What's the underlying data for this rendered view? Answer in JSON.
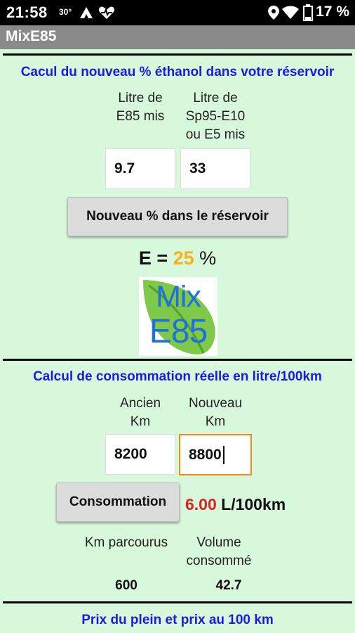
{
  "status_bar": {
    "time": "21:58",
    "temperature": "30°",
    "battery": "17 %"
  },
  "app": {
    "title": "MixE85"
  },
  "ethanol_section": {
    "title": "Cacul du nouveau % éthanol dans votre réservoir",
    "e85_label_line1": "Litre de",
    "e85_label_line2": "E85 mis",
    "sp95_label_line1": "Litre de",
    "sp95_label_line2": "Sp95-E10",
    "sp95_label_line3": "ou E5 mis",
    "e85_value": "9.7",
    "sp95_value": "33",
    "button_label": "Nouveau %  dans le réservoir",
    "result_prefix": "E = ",
    "result_value": "25",
    "result_unit": " %",
    "logo_line1": "Mix",
    "logo_line2": "E85"
  },
  "consumption_section": {
    "title": "Calcul de consommation réelle en litre/100km",
    "old_km_label_line1": "Ancien",
    "old_km_label_line2": "Km",
    "new_km_label_line1": "Nouveau",
    "new_km_label_line2": "Km",
    "old_km_value": "8200",
    "new_km_value": "8800",
    "button_label": "Consommation",
    "result_value": "6.00",
    "result_unit": " L/100km",
    "distance_label": "Km parcourus",
    "volume_label_line1": "Volume",
    "volume_label_line2": "consommé",
    "distance_value": "600",
    "volume_value": "42.7"
  },
  "price_section": {
    "title": "Prix du plein et prix au 100 km"
  },
  "colors": {
    "background": "#d8f8dc",
    "section_title": "#1a1ae6",
    "ethanol_result": "#f5b21c",
    "consumption_result": "#e32020",
    "focus_border": "#f08a1c"
  }
}
